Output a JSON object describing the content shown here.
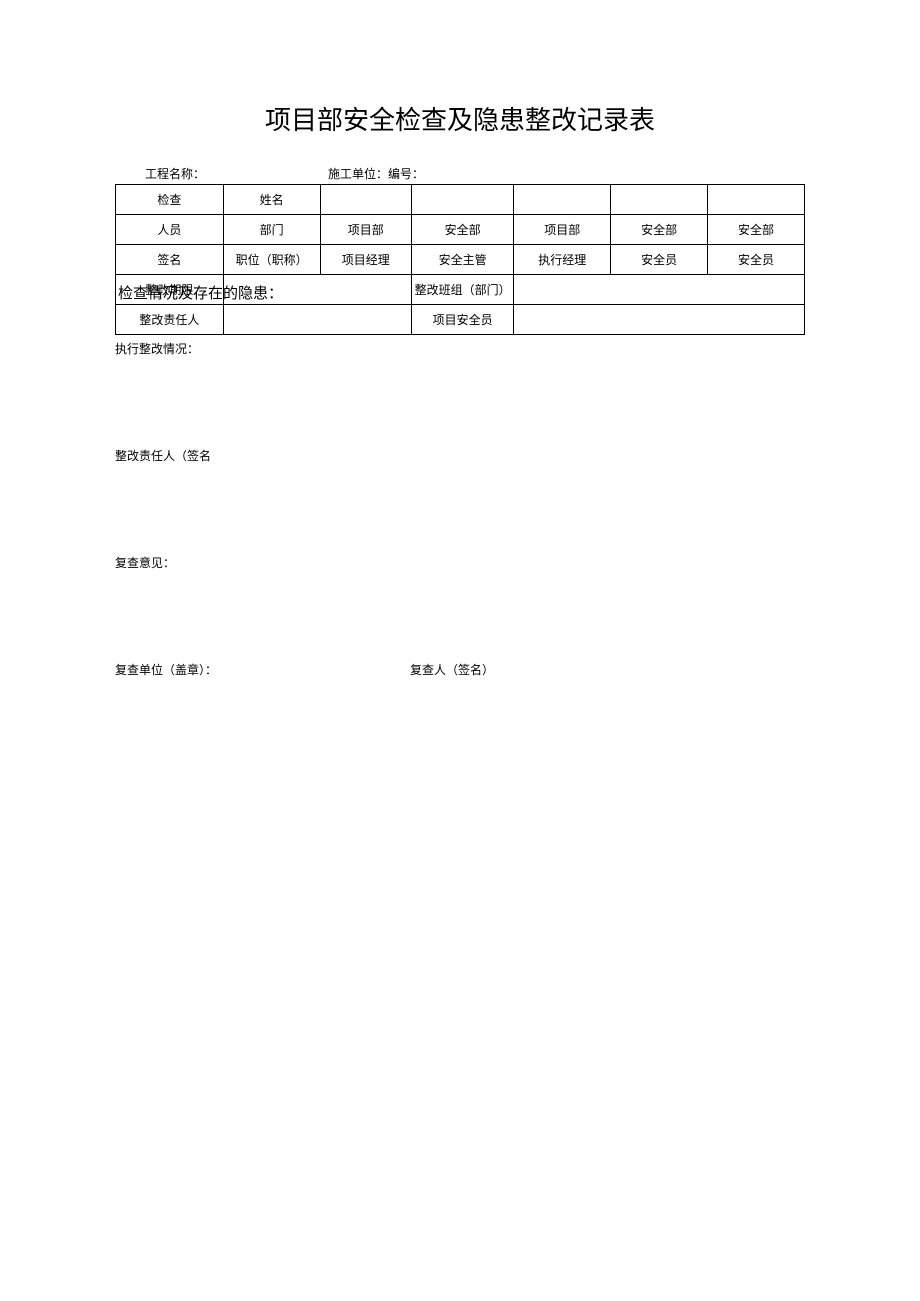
{
  "title": "项目部安全检查及隐患整改记录表",
  "header": {
    "project_label": "工程名称：",
    "unit_label": "施工单位：编号："
  },
  "table1": {
    "row1": {
      "c1": "检查",
      "c2": "姓名"
    },
    "row2": {
      "c1": "人员",
      "c2": "部门",
      "c3": "项目部",
      "c4": "安全部",
      "c5": "项目部",
      "c6": "安全部",
      "c7": "安全部"
    },
    "row3": {
      "c1": "签名",
      "c2": "职位（职称）",
      "c3": "项目经理",
      "c4": "安全主管",
      "c5": "执行经理",
      "c6": "安全员",
      "c7": "安全员"
    },
    "row4": {
      "c1": "整改期限",
      "c3": "整改班组（部门）"
    },
    "row5": {
      "c1": "整改责任人",
      "c3": "项目安全员"
    }
  },
  "overlay": "检查情况及存在的隐患：",
  "sections": {
    "s1": "执行整改情况：",
    "s2": "整改责任人（签名",
    "s3": "复查意见："
  },
  "review": {
    "r1": "复查单位（盖章）：",
    "r2": "复查人（签名）"
  }
}
